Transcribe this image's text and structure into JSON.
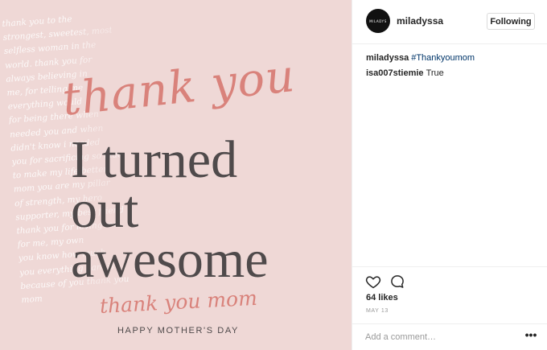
{
  "post_image": {
    "background_script_lines": [
      "thank you to the",
      "strongest, sweetest, most",
      "selfless woman in the",
      "world. thank you for",
      "always believing in",
      "me, for telling me",
      "everything would",
      "for being there when",
      "needed you and when",
      "didn't know i needed",
      "you for sacrificing so much",
      "to make my life better",
      "mom you are my pillar",
      "of strength, my hero",
      "supporter, my best friend",
      "thank you for loving me",
      "for me, my own",
      "you know how much",
      "you everything i am is",
      "because of you thank you",
      "mom"
    ],
    "script_title": "thank you",
    "headline_lines": [
      "I turned",
      "out",
      "awesome"
    ],
    "sub_script": "thank you mom",
    "footer_caption": "HAPPY MOTHER'S DAY",
    "colors": {
      "background": "#efd8d6",
      "accent": "#d9827b",
      "dark_text": "#4f4a4b"
    }
  },
  "header": {
    "avatar_text": "MILADYS",
    "username": "miladyssa",
    "follow_button_label": "Following"
  },
  "comments": [
    {
      "user": "miladyssa",
      "text": "#Thankyoumom",
      "is_hashtag": true
    },
    {
      "user": "isa007stiemie",
      "text": "True",
      "is_hashtag": false
    }
  ],
  "actions": {
    "like_icon": "heart-icon",
    "comment_icon": "speech-bubble-icon",
    "likes_text": "64 likes",
    "date_text": "MAY 13"
  },
  "add_comment": {
    "placeholder": "Add a comment…",
    "more_icon": "ellipsis-icon",
    "more_glyph": "•••"
  }
}
